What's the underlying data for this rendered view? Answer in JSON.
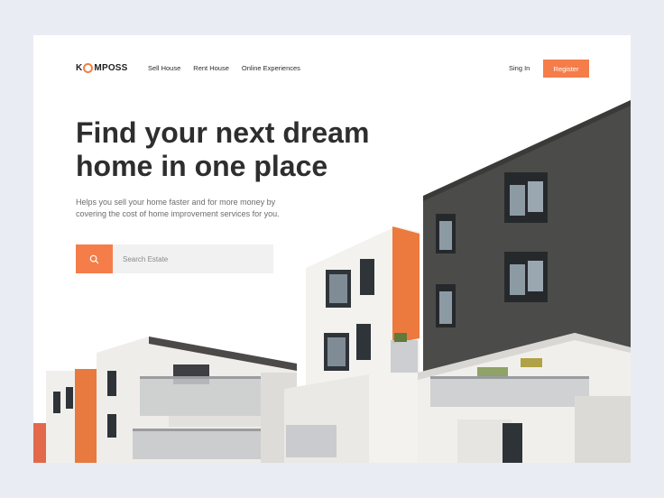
{
  "brand": {
    "logo_prefix": "K",
    "logo_suffix": "MPOSS",
    "accent": "#f47d4a"
  },
  "nav": {
    "items": [
      "Sell House",
      "Rent House",
      "Online Experiences"
    ]
  },
  "auth": {
    "signin_label": "Sing In",
    "register_label": "Register"
  },
  "hero": {
    "headline": "Find your next dream home in one place",
    "subtext": "Helps you sell your home faster and for more money by covering the cost of home improvement services for you."
  },
  "search": {
    "placeholder": "Search Estate",
    "icon": "search-icon"
  },
  "image": {
    "subject": "apartment-buildings"
  }
}
